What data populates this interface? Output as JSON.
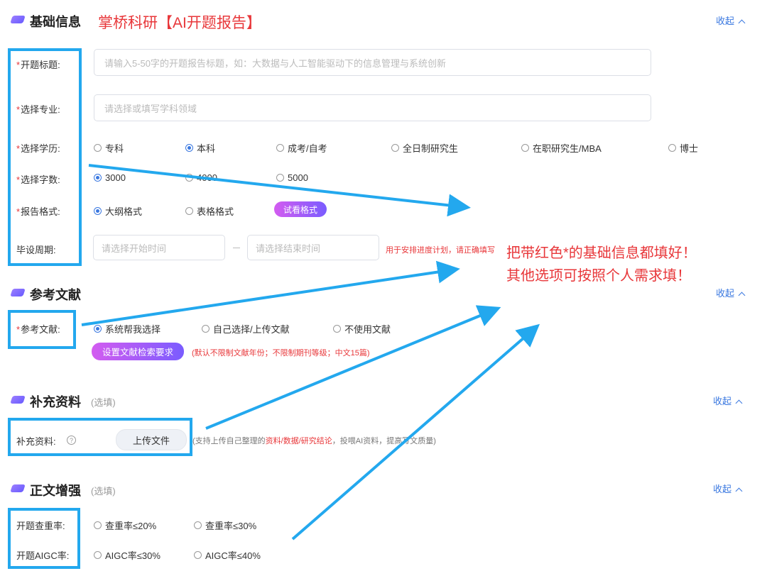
{
  "brand_title": "掌桥科研【AI开题报告】",
  "collapse_label": "收起",
  "sections": {
    "basic": {
      "title": "基础信息",
      "fields": {
        "topic_label": "开题标题:",
        "topic_placeholder": "请输入5-50字的开题报告标题，如：大数据与人工智能驱动下的信息管理与系统创新",
        "major_label": "选择专业:",
        "major_placeholder": "请选择或填写学科领域",
        "education_label": "选择学历:",
        "education_options": [
          "专科",
          "本科",
          "成考/自考",
          "全日制研究生",
          "在职研究生/MBA",
          "博士"
        ],
        "education_selected": "本科",
        "wordcount_label": "选择字数:",
        "wordcount_options": [
          "3000",
          "4000",
          "5000"
        ],
        "wordcount_selected": "3000",
        "format_label": "报告格式:",
        "format_options": [
          "大纲格式",
          "表格格式"
        ],
        "format_selected": "大纲格式",
        "format_preview_button": "试看格式",
        "period_label": "毕设周期:",
        "period_start_placeholder": "请选择开始时间",
        "period_end_placeholder": "请选择结束时间",
        "period_note": "用于安排进度计划，请正确填写"
      }
    },
    "references": {
      "title": "参考文献",
      "label": "参考文献:",
      "options": [
        "系统帮我选择",
        "自己选择/上传文献",
        "不使用文献"
      ],
      "selected": "系统帮我选择",
      "settings_button": "设置文献检索要求",
      "settings_note": "(默认不限制文献年份；不限制期刊等级；中文15篇)"
    },
    "supplement": {
      "title": "补充资料",
      "optional_tag": "(选填)",
      "label": "补充资料:",
      "help_icon_glyph": "?",
      "upload_button": "上传文件",
      "note_prefix": "(支持上传自己整理的",
      "note_highlight": "资料/数据/研究结论",
      "note_suffix": "，投喂AI资料，提高写文质量)"
    },
    "enhance": {
      "title": "正文增强",
      "optional_tag": "(选填)",
      "plagiarism_label": "开题查重率:",
      "plagiarism_options": [
        "查重率≤20%",
        "查重率≤30%"
      ],
      "aigc_label": "开题AIGC率:",
      "aigc_options": [
        "AIGC率≤30%",
        "AIGC率≤40%"
      ]
    }
  },
  "annotation": {
    "line1": "把带红色*的基础信息都填好！",
    "line2": "其他选项可按照个人需求填！"
  },
  "colors": {
    "accent_blue": "#3a78e0",
    "annotation_blue": "#23a8ee",
    "required_red": "#e8373a",
    "pill_gradient_start": "#d35cf0",
    "pill_gradient_end": "#7a5cff"
  }
}
